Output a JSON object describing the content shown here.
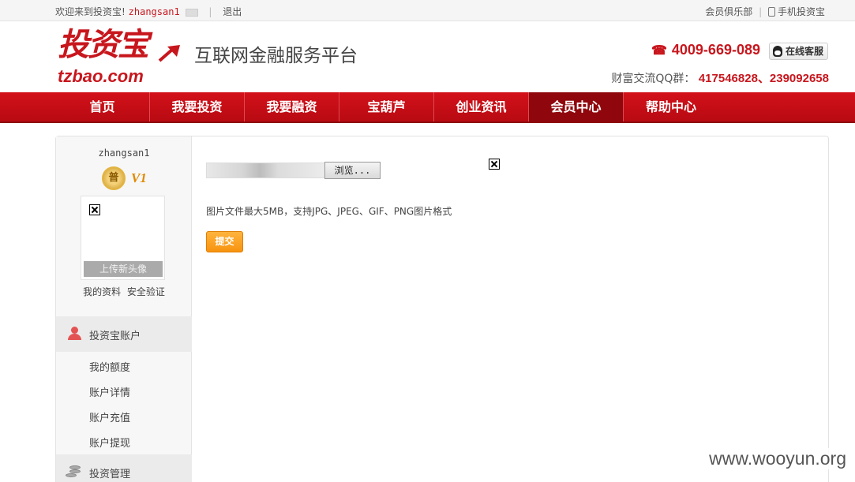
{
  "topbar": {
    "welcome": "欢迎来到投资宝!",
    "username": "zhangsan1",
    "logout": "退出",
    "club": "会员俱乐部",
    "mobile": "手机投资宝"
  },
  "header": {
    "logo_cn": "投资宝",
    "logo_en": "tzbao.com",
    "slogan": "互联网金融服务平台",
    "hotline": "4009-669-089",
    "service": "在线客服",
    "qq_label": "财富交流QQ群：",
    "qq_numbers": "417546828、239092658",
    "colors": {
      "brand": "#c8161d"
    }
  },
  "nav": {
    "items": [
      "首页",
      "我要投资",
      "我要融资",
      "宝葫芦",
      "创业资讯",
      "会员中心",
      "帮助中心"
    ],
    "active": "会员中心"
  },
  "sidebar": {
    "username": "zhangsan1",
    "level_badge": "普",
    "vip_level": "V1",
    "upload_avatar": "上传新头像",
    "links": [
      "我的资料",
      "安全验证"
    ],
    "account_section": {
      "title": "投资宝账户",
      "items": [
        "我的额度",
        "账户详情",
        "账户充值",
        "账户提现"
      ]
    },
    "manage_section": {
      "title": "投资管理"
    }
  },
  "content": {
    "browse_label": "浏览...",
    "hint": "图片文件最大5MB，支持JPG、JPEG、GIF、PNG图片格式",
    "submit_label": "提交"
  },
  "watermark": "www.wooyun.org"
}
